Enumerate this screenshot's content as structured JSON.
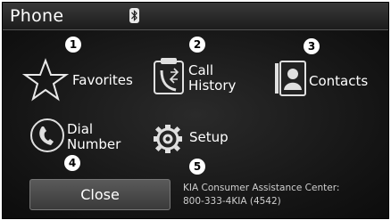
{
  "header": {
    "title": "Phone",
    "bluetooth_icon": "bluetooth-icon"
  },
  "menu": [
    {
      "label_lines": [
        "Favorites"
      ],
      "icon": "star-icon",
      "number": "1"
    },
    {
      "label_lines": [
        "Call",
        "History"
      ],
      "icon": "call-history-icon",
      "number": "2"
    },
    {
      "label_lines": [
        "Contacts"
      ],
      "icon": "contacts-icon",
      "number": "3"
    },
    {
      "label_lines": [
        "Dial",
        "Number"
      ],
      "icon": "handset-icon",
      "number": "4"
    },
    {
      "label_lines": [
        "Setup"
      ],
      "icon": "gear-icon",
      "number": "5"
    }
  ],
  "footer": {
    "close_label": "Close",
    "kia_line1": "KIA Consumer Assistance Center:",
    "kia_line2": "800-333-4KIA (4542)"
  },
  "colors": {
    "background": "#111111",
    "text": "#ffffff",
    "button": "#4a4a4a"
  }
}
